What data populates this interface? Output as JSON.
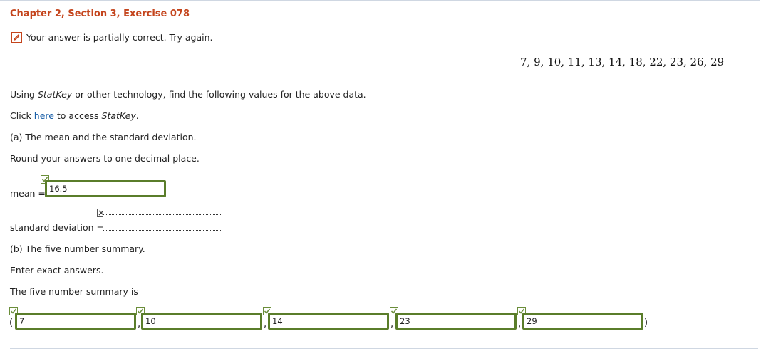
{
  "header": {
    "title": "Chapter 2, Section 3, Exercise 078"
  },
  "feedback": {
    "text": "Your answer is partially correct.  Try again.",
    "icon": "pencil-icon",
    "color": "#c4441c"
  },
  "dataset": {
    "text": "7, 9, 10, 11, 13, 14, 18, 22, 23, 26, 29"
  },
  "instructions": {
    "line1_prefix": "Using ",
    "line1_tool": "StatKey",
    "line1_suffix": " or other technology, find the following values for the above data.",
    "line2_prefix": "Click ",
    "line2_link": "here",
    "line2_middle": " to access ",
    "line2_tool": "StatKey",
    "line2_suffix": "."
  },
  "part_a": {
    "heading": "(a) The mean and the standard deviation.",
    "round_note": "Round your answers to one decimal place.",
    "mean_label": "mean =",
    "mean_value": "16.5",
    "mean_status": "correct",
    "sd_label": "standard deviation =",
    "sd_value": "",
    "sd_status": "incorrect"
  },
  "part_b": {
    "heading": "(b) The five number summary.",
    "exact_note": "Enter exact answers.",
    "summary_label": "The five number summary is",
    "open_paren": "(",
    "close_paren": ")",
    "comma": ",",
    "values": [
      "7",
      "10",
      "14",
      "23",
      "29"
    ],
    "statuses": [
      "correct",
      "correct",
      "correct",
      "correct",
      "correct"
    ]
  },
  "colors": {
    "title": "#c4441c",
    "correct_border": "#5a7d2a",
    "link": "#1a5fa8"
  }
}
